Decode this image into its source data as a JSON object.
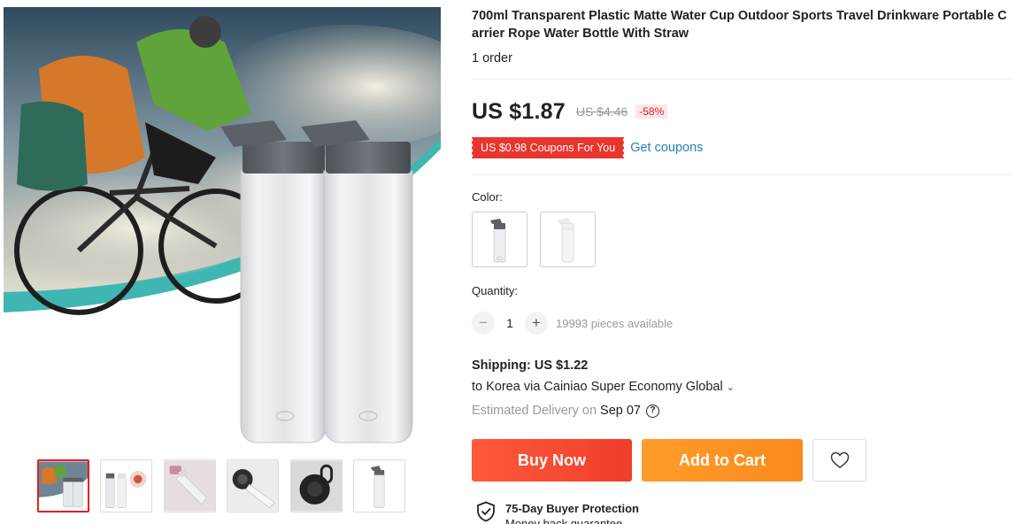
{
  "product": {
    "title": "700ml Transparent Plastic Matte Water Cup Outdoor Sports Travel Drinkware Portable Carrier Rope Water Bottle With Straw",
    "orders": "1 order"
  },
  "gallery": {
    "main_image_icon": "water-bottles-cyclist-photo",
    "thumbnails": [
      {
        "icon": "cyclist-bottles-thumb",
        "active": true
      },
      {
        "icon": "bottles-with-logo-thumb",
        "active": false
      },
      {
        "icon": "pink-bottle-thumb",
        "active": false
      },
      {
        "icon": "black-lid-thumb",
        "active": false
      },
      {
        "icon": "lid-closeup-thumb",
        "active": false
      },
      {
        "icon": "single-bottle-thumb",
        "active": false
      }
    ]
  },
  "price": {
    "current": "US $1.87",
    "original": "US $4.46",
    "discount": "-58%"
  },
  "coupon": {
    "tag": "US $0.98 Coupons For You",
    "link": "Get coupons"
  },
  "color": {
    "label": "Color:",
    "options": [
      {
        "name": "dark-lid-bottle",
        "selected": true
      },
      {
        "name": "clear-lid-bottle",
        "selected": false
      }
    ]
  },
  "quantity": {
    "label": "Quantity:",
    "minus": "−",
    "plus": "+",
    "value": "1",
    "available": "19993 pieces available"
  },
  "shipping": {
    "title": "Shipping: US $1.22",
    "method": "to Korea via Cainiao Super Economy Global",
    "chevron": "⌄",
    "delivery_label": "Estimated Delivery on",
    "delivery_date": "Sep 07",
    "help": "?"
  },
  "actions": {
    "buy_now": "Buy Now",
    "add_to_cart": "Add to Cart",
    "wishlist_icon": "heart-icon"
  },
  "protection": {
    "title": "75-Day Buyer Protection",
    "subtitle": "Money back guarantee"
  },
  "colors": {
    "price_red": "#e02020",
    "coupon_red": "#e9352d",
    "link_blue": "#2c7fb8",
    "buy_red": "#ef3d2b",
    "cart_orange": "#fb8a1c"
  }
}
